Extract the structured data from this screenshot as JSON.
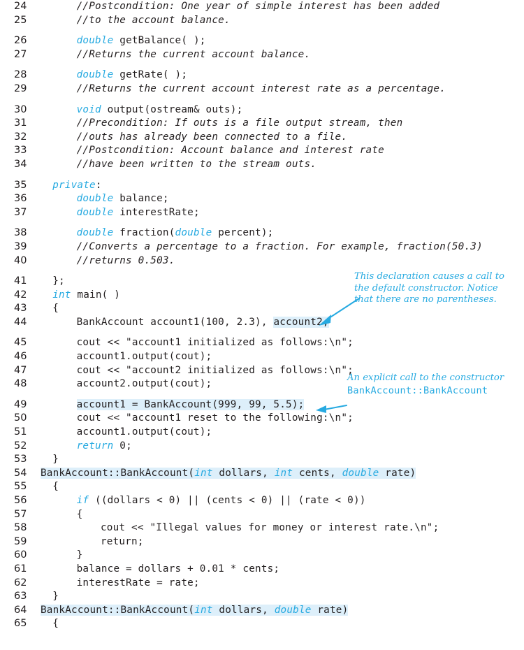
{
  "figure": {
    "kind": "code-listing",
    "language": "cpp",
    "keyword_color": "#27aae1",
    "highlight_color": "#ddeffa",
    "text_color": "#231f20",
    "background": "#ffffff",
    "first_line_number": 24,
    "last_line_number": 65
  },
  "lines": [
    {
      "no": "24",
      "indent": 6,
      "parts": [
        {
          "t": "//Postcondition: One year of simple interest has been added",
          "s": "cmt"
        }
      ]
    },
    {
      "no": "25",
      "indent": 6,
      "parts": [
        {
          "t": "//to the account balance.",
          "s": "cmt"
        }
      ]
    },
    {
      "no": "26",
      "indent": 6,
      "parts": [
        {
          "t": "double",
          "s": "kw"
        },
        {
          "t": " getBalance( );",
          "s": "plain"
        }
      ]
    },
    {
      "no": "27",
      "indent": 6,
      "parts": [
        {
          "t": "//Returns the current account balance.",
          "s": "cmt"
        }
      ]
    },
    {
      "no": "28",
      "indent": 6,
      "parts": [
        {
          "t": "double",
          "s": "kw"
        },
        {
          "t": " getRate( );",
          "s": "plain"
        }
      ]
    },
    {
      "no": "29",
      "indent": 6,
      "parts": [
        {
          "t": "//Returns the current account interest rate as a percentage.",
          "s": "cmt"
        }
      ]
    },
    {
      "no": "30",
      "indent": 6,
      "parts": [
        {
          "t": "void",
          "s": "kw"
        },
        {
          "t": " output(ostream& outs);",
          "s": "plain"
        }
      ]
    },
    {
      "no": "31",
      "indent": 6,
      "parts": [
        {
          "t": "//Precondition: If outs is a file output stream, then",
          "s": "cmt"
        }
      ]
    },
    {
      "no": "32",
      "indent": 6,
      "parts": [
        {
          "t": "//outs has already been connected to a file.",
          "s": "cmt"
        }
      ]
    },
    {
      "no": "33",
      "indent": 6,
      "parts": [
        {
          "t": "//Postcondition: Account balance and interest rate",
          "s": "cmt"
        }
      ]
    },
    {
      "no": "34",
      "indent": 6,
      "parts": [
        {
          "t": "//have been written to the stream outs.",
          "s": "cmt"
        }
      ]
    },
    {
      "no": "35",
      "indent": 2,
      "parts": [
        {
          "t": "private",
          "s": "kw"
        },
        {
          "t": ":",
          "s": "plain"
        }
      ]
    },
    {
      "no": "36",
      "indent": 6,
      "parts": [
        {
          "t": "double",
          "s": "kw"
        },
        {
          "t": " balance;",
          "s": "plain"
        }
      ]
    },
    {
      "no": "37",
      "indent": 6,
      "parts": [
        {
          "t": "double",
          "s": "kw"
        },
        {
          "t": " interestRate;",
          "s": "plain"
        }
      ]
    },
    {
      "no": "38",
      "indent": 6,
      "parts": [
        {
          "t": "double",
          "s": "kw"
        },
        {
          "t": " fraction(",
          "s": "plain"
        },
        {
          "t": "double",
          "s": "kw"
        },
        {
          "t": " percent);",
          "s": "plain"
        }
      ]
    },
    {
      "no": "39",
      "indent": 6,
      "parts": [
        {
          "t": "//Converts a percentage to a fraction. For example, fraction(50.3)",
          "s": "cmt"
        }
      ]
    },
    {
      "no": "40",
      "indent": 6,
      "parts": [
        {
          "t": "//returns 0.503.",
          "s": "cmt"
        }
      ]
    },
    {
      "no": "41",
      "indent": 2,
      "parts": [
        {
          "t": "};",
          "s": "plain"
        }
      ]
    },
    {
      "no": "42",
      "indent": 2,
      "parts": [
        {
          "t": "int",
          "s": "kw"
        },
        {
          "t": " main( )",
          "s": "plain"
        }
      ]
    },
    {
      "no": "43",
      "indent": 2,
      "parts": [
        {
          "t": "{",
          "s": "plain"
        }
      ]
    },
    {
      "no": "44",
      "indent": 6,
      "parts": [
        {
          "t": "BankAccount account1(100, 2.3), ",
          "s": "plain"
        },
        {
          "t": "account2;",
          "s": "hl"
        }
      ]
    },
    {
      "no": "45",
      "indent": 6,
      "parts": [
        {
          "t": "cout << \"account1 initialized as follows:\\n\";",
          "s": "plain"
        }
      ]
    },
    {
      "no": "46",
      "indent": 6,
      "parts": [
        {
          "t": "account1.output(cout);",
          "s": "plain"
        }
      ]
    },
    {
      "no": "47",
      "indent": 6,
      "parts": [
        {
          "t": "cout << \"account2 initialized as follows:\\n\";",
          "s": "plain"
        }
      ]
    },
    {
      "no": "48",
      "indent": 6,
      "parts": [
        {
          "t": "account2.output(cout);",
          "s": "plain"
        }
      ]
    },
    {
      "no": "49",
      "indent": 6,
      "parts": [
        {
          "t": "account1 = BankAccount(999, 99, 5.5);",
          "s": "hl"
        }
      ]
    },
    {
      "no": "50",
      "indent": 6,
      "parts": [
        {
          "t": "cout << \"account1 reset to the following:\\n\";",
          "s": "plain"
        }
      ]
    },
    {
      "no": "51",
      "indent": 6,
      "parts": [
        {
          "t": "account1.output(cout);",
          "s": "plain"
        }
      ]
    },
    {
      "no": "52",
      "indent": 6,
      "parts": [
        {
          "t": "return",
          "s": "kw"
        },
        {
          "t": " 0;",
          "s": "plain"
        }
      ]
    },
    {
      "no": "53",
      "indent": 2,
      "parts": [
        {
          "t": "}",
          "s": "plain"
        }
      ]
    },
    {
      "no": "54",
      "indent": 0,
      "parts": [
        {
          "t": "BankAccount::BankAccount(",
          "s": "hl"
        },
        {
          "t": "int",
          "s": "hlkw"
        },
        {
          "t": " dollars, ",
          "s": "hl"
        },
        {
          "t": "int",
          "s": "hlkw"
        },
        {
          "t": " cents, ",
          "s": "hl"
        },
        {
          "t": "double",
          "s": "hlkw"
        },
        {
          "t": " rate)",
          "s": "hl"
        }
      ]
    },
    {
      "no": "55",
      "indent": 2,
      "parts": [
        {
          "t": "{",
          "s": "plain"
        }
      ]
    },
    {
      "no": "56",
      "indent": 6,
      "parts": [
        {
          "t": "if",
          "s": "kw"
        },
        {
          "t": " ((dollars < 0) || (cents < 0) || (rate < 0))",
          "s": "plain"
        }
      ]
    },
    {
      "no": "57",
      "indent": 6,
      "parts": [
        {
          "t": "{",
          "s": "plain"
        }
      ]
    },
    {
      "no": "58",
      "indent": 10,
      "parts": [
        {
          "t": "cout << \"Illegal values for money or interest rate.\\n\";",
          "s": "plain"
        }
      ]
    },
    {
      "no": "59",
      "indent": 10,
      "parts": [
        {
          "t": "return;",
          "s": "plain"
        }
      ]
    },
    {
      "no": "60",
      "indent": 6,
      "parts": [
        {
          "t": "}",
          "s": "plain"
        }
      ]
    },
    {
      "no": "61",
      "indent": 6,
      "parts": [
        {
          "t": "balance = dollars + 0.01 * cents;",
          "s": "plain"
        }
      ]
    },
    {
      "no": "62",
      "indent": 6,
      "parts": [
        {
          "t": "interestRate = rate;",
          "s": "plain"
        }
      ]
    },
    {
      "no": "63",
      "indent": 2,
      "parts": [
        {
          "t": "}",
          "s": "plain"
        }
      ]
    },
    {
      "no": "64",
      "indent": 0,
      "parts": [
        {
          "t": "BankAccount::BankAccount(",
          "s": "hl"
        },
        {
          "t": "int",
          "s": "hlkw"
        },
        {
          "t": " dollars, ",
          "s": "hl"
        },
        {
          "t": "double",
          "s": "hlkw"
        },
        {
          "t": " rate)",
          "s": "hl"
        }
      ]
    },
    {
      "no": "65",
      "indent": 2,
      "parts": [
        {
          "t": "{",
          "s": "plain"
        }
      ]
    }
  ],
  "blank_after": [
    "25",
    "27",
    "29",
    "34",
    "37",
    "40",
    "44",
    "48"
  ],
  "annotations": [
    {
      "id": "default-constructor-note",
      "text": "This declaration causes a call to\nthe default constructor. Notice\nthat there are no parentheses.",
      "mono_text": "",
      "target_line": "44"
    },
    {
      "id": "explicit-constructor-call-note",
      "text": "An explicit call to the constructor",
      "mono_text": "BankAccount::BankAccount",
      "target_line": "49"
    }
  ]
}
